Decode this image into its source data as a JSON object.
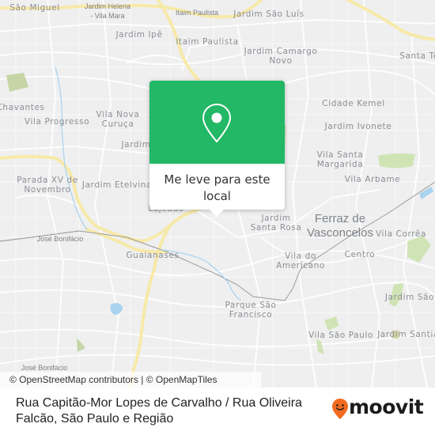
{
  "map": {
    "colors": {
      "background": "#efefef",
      "road_minor": "#ffffff",
      "road_major": "#f7e9a8",
      "water": "#a9d3ef",
      "park": "#cfe4b4",
      "label": "#8b8f96",
      "rail": "#9a9a9a"
    },
    "labels": [
      {
        "id": "sao-miguel",
        "text": "São Miguel"
      },
      {
        "id": "jardim-helena",
        "text": "Jardim Helena\n- Vila Mara"
      },
      {
        "id": "itaim-paulista-1",
        "text": "Itaim Paulista"
      },
      {
        "id": "jardim-sao-luis",
        "text": "Jardim São Luís"
      },
      {
        "id": "jardim-ipe",
        "text": "Jardim Ipê"
      },
      {
        "id": "itaim-paulista-2",
        "text": "Itaim Paulista"
      },
      {
        "id": "jardim-camargo-novo",
        "text": "Jardim Camargo\nNovo"
      },
      {
        "id": "santa-te",
        "text": "Santa Te"
      },
      {
        "id": "chavantes",
        "text": "Chavantes"
      },
      {
        "id": "vila-progresso",
        "text": "Vila Progresso"
      },
      {
        "id": "vila-nova-curuca",
        "text": "Vila Nova\nCuruça"
      },
      {
        "id": "jardim-partial",
        "text": "Jardim"
      },
      {
        "id": "cidade-kemel",
        "text": "Cidade Kemel"
      },
      {
        "id": "jardim-ivonete",
        "text": "Jardim Ivonete"
      },
      {
        "id": "vila-santa-margarida",
        "text": "Vila Santa\nMargarida"
      },
      {
        "id": "parada-xv",
        "text": "Parada XV de\nNovembro"
      },
      {
        "id": "jardim-etelvina",
        "text": "Jardim Etelvina"
      },
      {
        "id": "vila-arbame",
        "text": "Vila Arbame"
      },
      {
        "id": "lajeado",
        "text": "Lajeado"
      },
      {
        "id": "jardim-santa-rosa",
        "text": "Jardim\nSanta Rosa"
      },
      {
        "id": "ferraz-de-vasconcelos",
        "text": "Ferraz de\nVasconcelos"
      },
      {
        "id": "vila-correa",
        "text": "Vila Corrêa"
      },
      {
        "id": "jose-bonifacio-1",
        "text": "José Bonifácio"
      },
      {
        "id": "guaianases",
        "text": "Guaianases"
      },
      {
        "id": "vila-do-americano",
        "text": "Vila do\nAmericano"
      },
      {
        "id": "centro",
        "text": "Centro"
      },
      {
        "id": "parque-sao-francisco",
        "text": "Parque São\nFrancisco"
      },
      {
        "id": "jardim-sao",
        "text": "Jardim São"
      },
      {
        "id": "vila-sao-paulo",
        "text": "Vila São Paulo"
      },
      {
        "id": "jardim-santia",
        "text": "Jardim Santia"
      },
      {
        "id": "jose-bonifacio-2",
        "text": "José Bonifácio"
      }
    ],
    "attribution": "© OpenStreetMap contributors | © OpenMapTiles"
  },
  "popup": {
    "icon": "map-pin-icon",
    "action_label": "Me leve para este local",
    "header_color": "#22b866"
  },
  "footer": {
    "address": "Rua Capitão-Mor Lopes de Carvalho / Rua Oliveira Falcão, São Paulo e Região",
    "brand": "moovit",
    "brand_color": "#f26b21"
  }
}
